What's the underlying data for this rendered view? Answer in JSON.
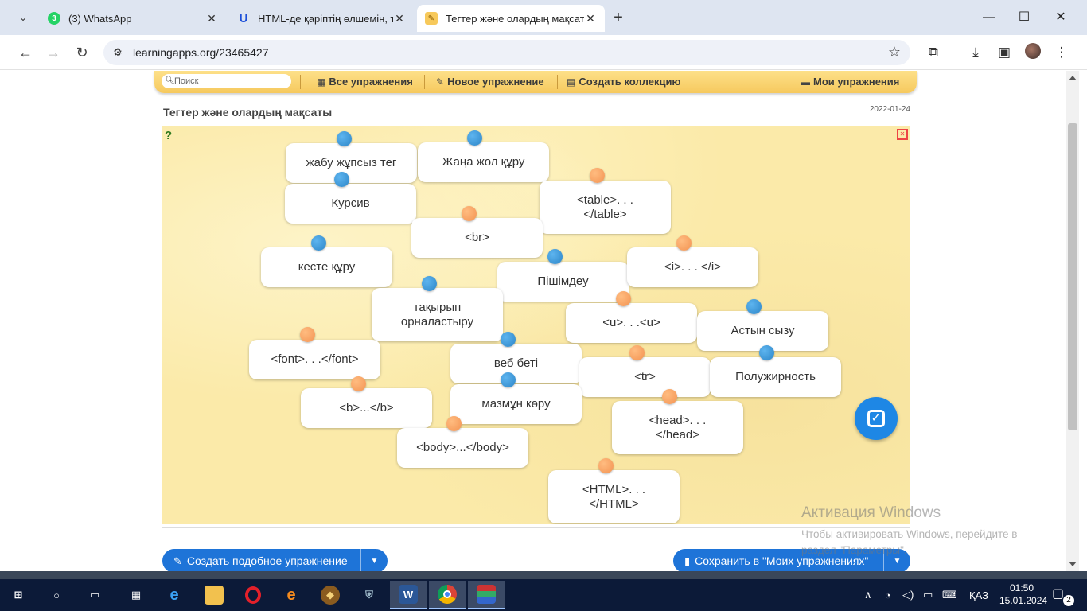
{
  "browser": {
    "tabs": [
      {
        "title": "(3) WhatsApp",
        "badge": "3",
        "icon": "whatsapp-icon",
        "icon_color": "#25d366",
        "active": false
      },
      {
        "title": "HTML-де қаріптің өлшемін, түр",
        "badge": "U",
        "icon": "udemy-icon",
        "icon_color": "#1c4fd9",
        "active": false
      },
      {
        "title": "Тегтер және олардың мақсаты",
        "badge": "",
        "icon": "learningapps-icon",
        "icon_color": "#f7c95b",
        "active": true
      }
    ],
    "new_tab": "+",
    "window_controls": {
      "minimize": "—",
      "maximize": "☐",
      "close": "✕"
    },
    "url": "learningapps.org/23465427"
  },
  "site_nav": {
    "search_placeholder": "Поиск",
    "all_exercises": "Все упражнения",
    "new_exercise": "Новое упражнение",
    "create_collection": "Создать коллекцию",
    "my_exercises": "Мои упражнения"
  },
  "exercise": {
    "title": "Тегтер және олардың мақсаты",
    "date": "2022-01-24",
    "cards": [
      {
        "text": "жабу жұпсыз тег",
        "pin": "blue"
      },
      {
        "text": "Жаңа жол құру",
        "pin": "blue"
      },
      {
        "text": "Курсив",
        "pin": "blue"
      },
      {
        "text": "<table>. . .\n</table>",
        "pin": "orange"
      },
      {
        "text": "<br>",
        "pin": "orange"
      },
      {
        "text": "кесте құру",
        "pin": "blue"
      },
      {
        "text": "Пішімдеу",
        "pin": "blue"
      },
      {
        "text": "<i>. . . </i>",
        "pin": "orange"
      },
      {
        "text": "тақырып\nорналастыру",
        "pin": "blue"
      },
      {
        "text": "<u>. . .<u>",
        "pin": "orange"
      },
      {
        "text": "Астын сызу",
        "pin": "blue"
      },
      {
        "text": "<font>. . .</font>",
        "pin": "orange"
      },
      {
        "text": "веб беті",
        "pin": "blue"
      },
      {
        "text": "<tr>",
        "pin": "orange"
      },
      {
        "text": "Полужирность",
        "pin": "blue"
      },
      {
        "text": "<b>...</b>",
        "pin": "orange"
      },
      {
        "text": "мазмұн көру",
        "pin": "blue"
      },
      {
        "text": "<head>. . .\n</head>",
        "pin": "orange"
      },
      {
        "text": "<body>...</body>",
        "pin": "orange"
      },
      {
        "text": "<HTML>. . .\n</HTML>",
        "pin": "orange"
      }
    ],
    "pin_colors": {
      "blue": "#2d86c8",
      "orange": "#f39352"
    }
  },
  "buttons": {
    "create_similar": "Создать подобное упражнение",
    "save_to_mine": "Сохранить в \"Моих упражнениях\""
  },
  "watermark": {
    "title": "Активация Windows",
    "line1": "Чтобы активировать Windows, перейдите в",
    "line2": "раздел \"Параметры\"."
  },
  "taskbar": {
    "language": "ҚАЗ",
    "time": "01:50",
    "date": "15.01.2024",
    "notifications": "2"
  }
}
